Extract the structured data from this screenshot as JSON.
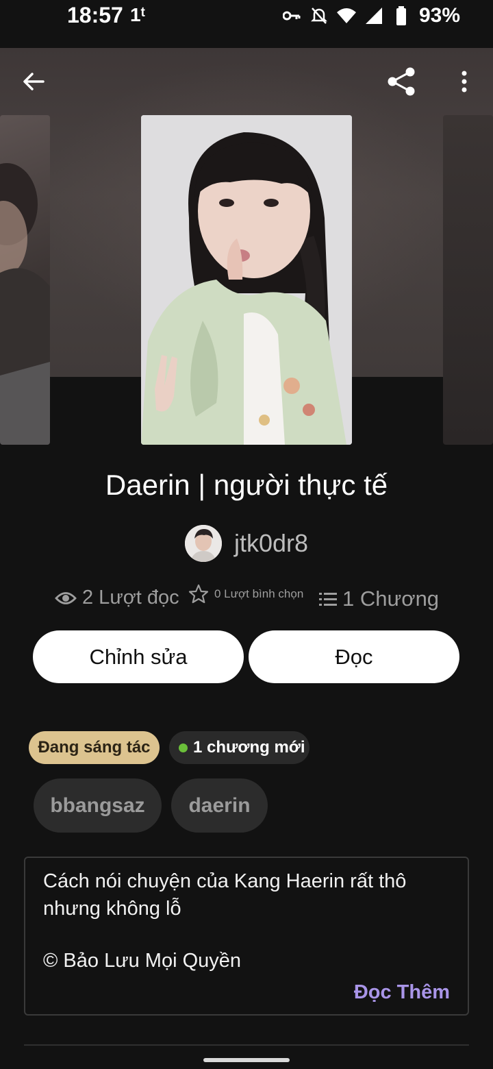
{
  "status_bar": {
    "time": "18:57",
    "extra": "1ᵗ",
    "battery": "93%",
    "icons": [
      "key-icon",
      "bell-off-icon",
      "wifi-icon",
      "signal-icon",
      "battery-icon"
    ]
  },
  "app_bar": {
    "back_icon": "arrow-left-icon",
    "share_icon": "share-icon",
    "more_icon": "more-vertical-icon"
  },
  "story": {
    "title": "Daerin | người thực tế",
    "author": "jtk0dr8"
  },
  "stats": {
    "reads": "2 Lượt đọc",
    "votes": "0 Lượt bình chọn",
    "parts": "1 Chương"
  },
  "actions": {
    "edit": "Chỉnh sửa",
    "read": "Đọc"
  },
  "chips": {
    "status": "Đang sáng tác",
    "new_chapters": "1 chương mới"
  },
  "tags": [
    "bbangsaz",
    "daerin"
  ],
  "description": {
    "text": "Cách nói chuyện của Kang Haerin rất thô\nnhưng không lỗ",
    "copyright": "© Bảo Lưu Mọi Quyền",
    "read_more": "Đọc Thêm"
  },
  "colors": {
    "background": "#121212",
    "status_chip": "#dcc38f",
    "accent": "#a995e8",
    "new_dot": "#6bbf3a"
  }
}
